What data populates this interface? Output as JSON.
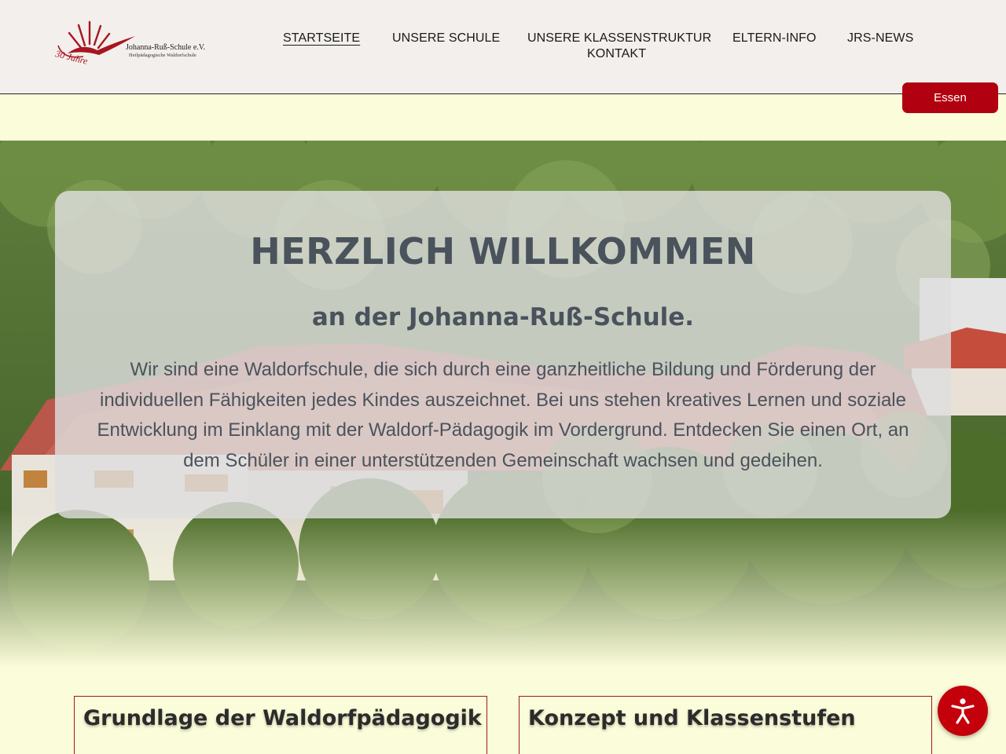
{
  "logo": {
    "name": "Johanna-Ruß-Schule e.V.",
    "subtitle": "Heilpädagogische Waldorfschule",
    "years": "30 Jahre",
    "color": "#a81520"
  },
  "nav": {
    "items": [
      {
        "label": "STARTSEITE",
        "active": true
      },
      {
        "label": "UNSERE SCHULE"
      },
      {
        "label": "UNSERE KLASSENSTRUKTUR"
      },
      {
        "label": "ELTERN-INFO"
      },
      {
        "label": "JRS-NEWS"
      },
      {
        "label": "KONTAKT"
      }
    ]
  },
  "essen_button": {
    "label": "Essen",
    "color": "#b1000f"
  },
  "welcome": {
    "title": "HERZLICH WILLKOMMEN",
    "subtitle": "an der Johanna-Ruß-Schule.",
    "text": "Wir sind eine Waldorfschule, die sich durch eine ganzheitliche Bildung und Förderung der individuellen Fähigkeiten jedes Kindes auszeichnet. Bei uns stehen kreatives Lernen und soziale Entwicklung im Einklang mit der Waldorf-Pädagogik im Vordergrund. Entdecken Sie einen Ort, an dem Schüler in einer unterstützenden Gemeinschaft wachsen und gedeihen."
  },
  "cards": [
    {
      "title": "Grundlage der Waldorfpädagogik"
    },
    {
      "title": "Konzept und Klassenstufen"
    }
  ],
  "accessibility_button": {
    "icon": "accessibility-icon",
    "color": "#c4000a"
  },
  "colors": {
    "header_bg": "#f2efec",
    "page_bg": "#fbfcd9",
    "text": "#4a535c",
    "accent": "#b1000f"
  }
}
